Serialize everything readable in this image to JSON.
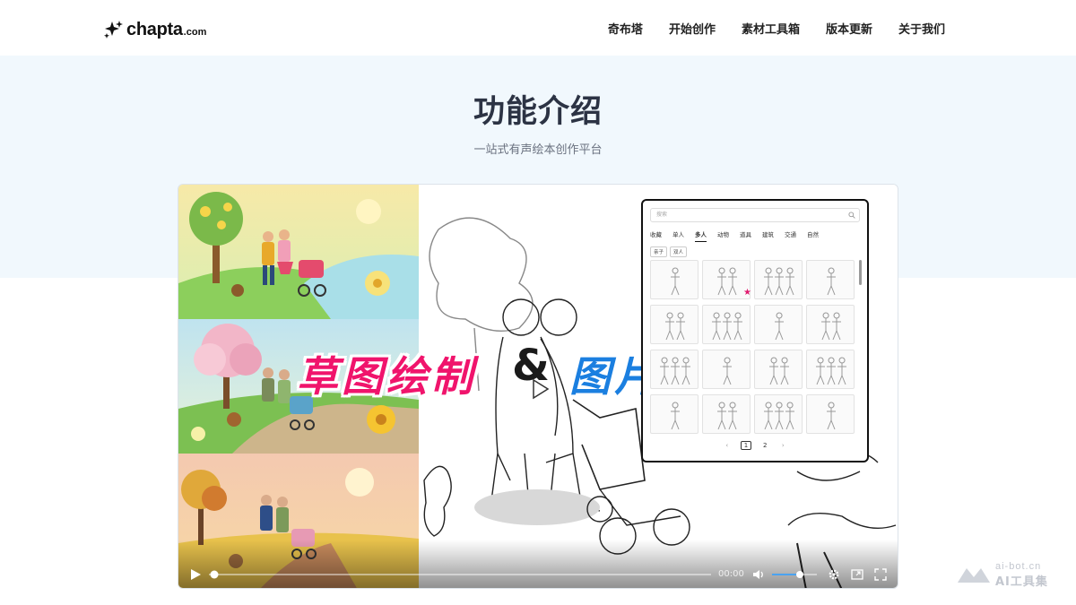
{
  "header": {
    "logo_name": "chapta",
    "logo_suffix": ".com",
    "nav": [
      "奇布塔",
      "开始创作",
      "素材工具箱",
      "版本更新",
      "关于我们"
    ]
  },
  "hero": {
    "title": "功能介绍",
    "subtitle": "一站式有声绘本创作平台"
  },
  "video": {
    "overlay_left": "草图绘制",
    "overlay_amp": "&",
    "overlay_right": "图片转绘",
    "time": "00:00",
    "progress": 0,
    "volume": 0.62
  },
  "asset_panel": {
    "search_placeholder": "搜索",
    "tabs": [
      "收藏",
      "单人",
      "多人",
      "动物",
      "道具",
      "建筑",
      "交通",
      "自然"
    ],
    "active_tab": "多人",
    "chips": [
      "亲子",
      "双人"
    ],
    "pages": [
      "1",
      "2"
    ],
    "current_page": "1"
  },
  "watermark": {
    "line1": "ai-bot.cn",
    "line2": "AI工具集"
  },
  "colors": {
    "hero_bg": "#f1f8fd",
    "overlay_pink": "#f0146c",
    "overlay_blue": "#1b7fe0",
    "favorite_star": "#e0196e"
  }
}
